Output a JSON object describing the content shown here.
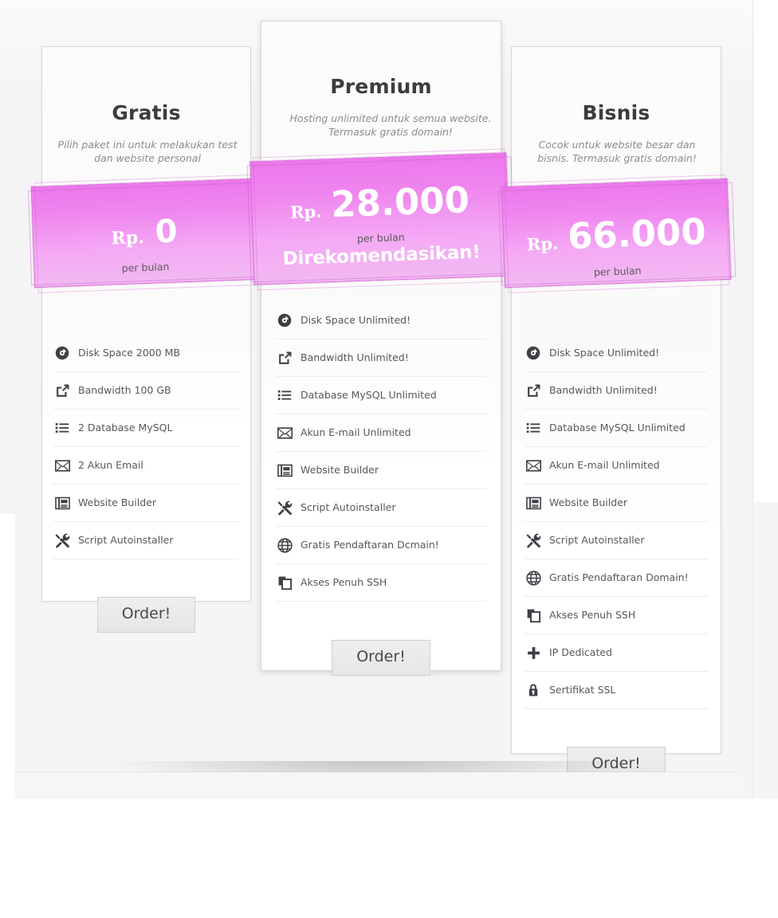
{
  "page": {
    "accent_color": "#ee82ee",
    "accent_color_light": "#f2b9f2",
    "card_border_color": "#d8d8d8",
    "background_color": "#f5f5f5",
    "text_color": "#585858"
  },
  "plans": [
    {
      "id": "gratis",
      "name": "Gratis",
      "description": "Pilih paket ini untuk melakukan test dan website personal",
      "currency": "Rp.",
      "price": "0",
      "period": "per bulan",
      "badge": "",
      "order_label": "Order!",
      "features": [
        {
          "icon": "disc-icon",
          "label": "Disk Space 2000 MB"
        },
        {
          "icon": "share-icon",
          "label": "Bandwidth 100 GB"
        },
        {
          "icon": "list-icon",
          "label": "2 Database MySQL"
        },
        {
          "icon": "envelope-icon",
          "label": "2 Akun Email"
        },
        {
          "icon": "browser-icon",
          "label": "Website Builder"
        },
        {
          "icon": "tools-icon",
          "label": "Script Autoinstaller"
        }
      ]
    },
    {
      "id": "premium",
      "name": "Premium",
      "description": "Hosting unlimited untuk semua website. Termasuk gratis domain!",
      "currency": "Rp.",
      "price": "28.000",
      "period": "per bulan",
      "badge": "Direkomendasikan!",
      "order_label": "Order!",
      "features": [
        {
          "icon": "disc-icon",
          "label": "Disk Space Unlimited!"
        },
        {
          "icon": "share-icon",
          "label": "Bandwidth Unlimited!"
        },
        {
          "icon": "list-icon",
          "label": "Database MySQL Unlimited"
        },
        {
          "icon": "envelope-icon",
          "label": "Akun E-mail Unlimited"
        },
        {
          "icon": "browser-icon",
          "label": "Website Builder"
        },
        {
          "icon": "tools-icon",
          "label": "Script Autoinstaller"
        },
        {
          "icon": "globe-icon",
          "label": "Gratis Pendaftaran Dcmain!"
        },
        {
          "icon": "copy-icon",
          "label": "Akses Penuh SSH"
        }
      ]
    },
    {
      "id": "bisnis",
      "name": "Bisnis",
      "description": "Cocok untuk website besar dan bisnis. Termasuk gratis domain!",
      "currency": "Rp.",
      "price": "66.000",
      "period": "per bulan",
      "badge": "",
      "order_label": "Order!",
      "features": [
        {
          "icon": "disc-icon",
          "label": "Disk Space Unlimited!"
        },
        {
          "icon": "share-icon",
          "label": "Bandwidth Unlimited!"
        },
        {
          "icon": "list-icon",
          "label": "Database MySQL Unlimited"
        },
        {
          "icon": "envelope-icon",
          "label": "Akun E-mail Unlimited"
        },
        {
          "icon": "browser-icon",
          "label": "Website Builder"
        },
        {
          "icon": "tools-icon",
          "label": "Script Autoinstaller"
        },
        {
          "icon": "globe-icon",
          "label": "Gratis Pendaftaran Domain!"
        },
        {
          "icon": "copy-icon",
          "label": "Akses Penuh SSH"
        },
        {
          "icon": "plus-icon",
          "label": "IP Dedicated"
        },
        {
          "icon": "lock-icon",
          "label": "Sertifikat SSL"
        }
      ]
    }
  ]
}
